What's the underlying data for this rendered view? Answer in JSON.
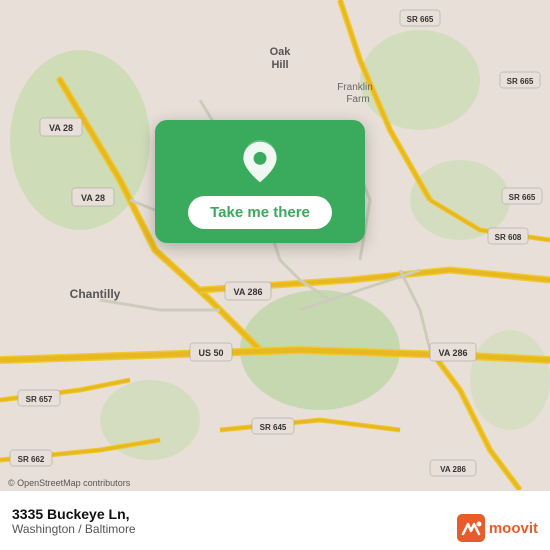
{
  "map": {
    "alt": "Map of Chantilly area, Washington/Baltimore",
    "attribution": "© OpenStreetMap contributors",
    "bg_color": "#e8e0d8"
  },
  "card": {
    "button_label": "Take me there",
    "pin_color": "#ffffff"
  },
  "footer": {
    "address": "3335 Buckeye Ln,",
    "city": "Washington / Baltimore",
    "moovit_label": "moovit"
  }
}
